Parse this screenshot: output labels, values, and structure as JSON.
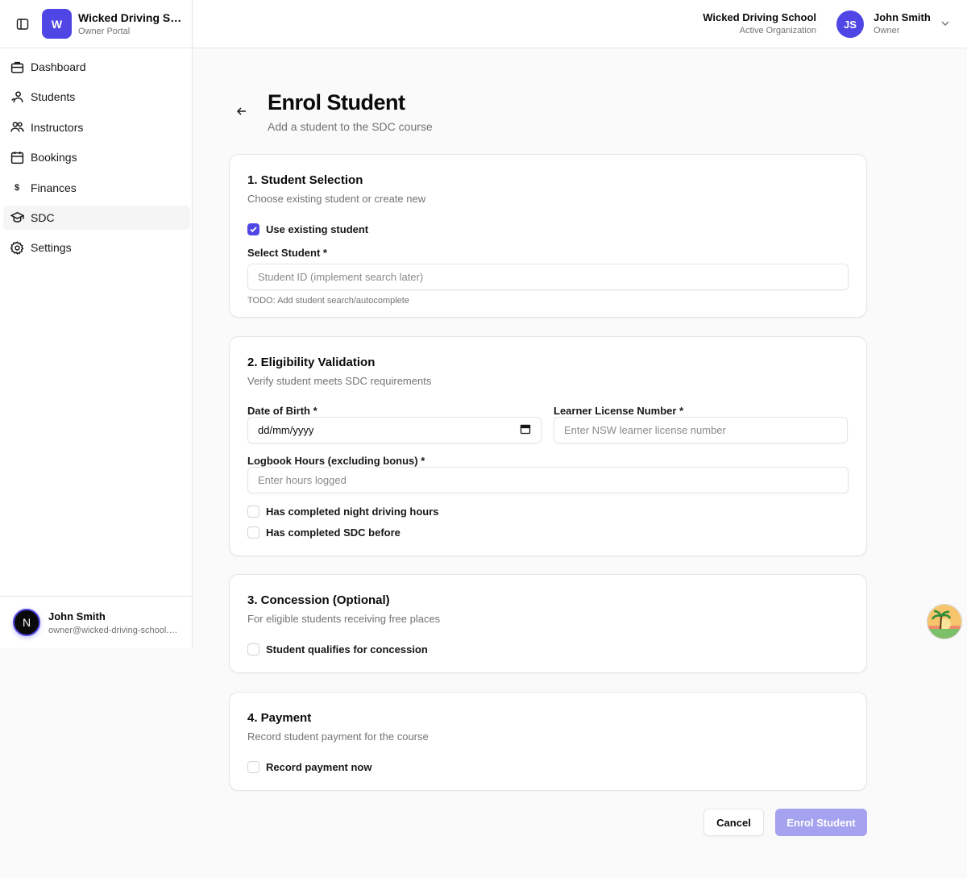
{
  "sidebar": {
    "org_logo_letter": "W",
    "org_name": "Wicked Driving School",
    "org_subtitle": "Owner Portal",
    "items": [
      {
        "label": "Dashboard",
        "icon": "briefcase-icon"
      },
      {
        "label": "Students",
        "icon": "student-icon"
      },
      {
        "label": "Instructors",
        "icon": "users-icon"
      },
      {
        "label": "Bookings",
        "icon": "calendar-icon"
      },
      {
        "label": "Finances",
        "icon": "dollar-icon"
      },
      {
        "label": "SDC",
        "icon": "graduation-cap-icon",
        "active": true
      },
      {
        "label": "Settings",
        "icon": "gear-icon"
      }
    ],
    "footer": {
      "avatar_letter": "N",
      "name": "John Smith",
      "email": "owner@wicked-driving-school.com"
    }
  },
  "header": {
    "org_name": "Wicked Driving School",
    "org_status": "Active Organization",
    "user_initials": "JS",
    "user_name": "John Smith",
    "user_role": "Owner"
  },
  "page": {
    "title": "Enrol Student",
    "subtitle": "Add a student to the SDC course"
  },
  "sections": {
    "student_selection": {
      "title": "1. Student Selection",
      "description": "Choose existing student or create new",
      "use_existing_label": "Use existing student",
      "use_existing_checked": true,
      "select_label": "Select Student *",
      "select_placeholder": "Student ID (implement search later)",
      "hint": "TODO: Add student search/autocomplete"
    },
    "eligibility": {
      "title": "2. Eligibility Validation",
      "description": "Verify student meets SDC requirements",
      "dob_label": "Date of Birth *",
      "dob_value": "dd/mm/yyyy",
      "license_label": "Learner License Number *",
      "license_placeholder": "Enter NSW learner license number",
      "logbook_label": "Logbook Hours (excluding bonus) *",
      "logbook_placeholder": "Enter hours logged",
      "night_label": "Has completed night driving hours",
      "sdc_before_label": "Has completed SDC before"
    },
    "concession": {
      "title": "3. Concession (Optional)",
      "description": "For eligible students receiving free places",
      "qualifies_label": "Student qualifies for concession"
    },
    "payment": {
      "title": "4. Payment",
      "description": "Record student payment for the course",
      "record_label": "Record payment now"
    }
  },
  "actions": {
    "cancel": "Cancel",
    "submit": "Enrol Student"
  },
  "colors": {
    "accent": "#4f46e5",
    "accent_disabled": "#a5a2f0"
  }
}
